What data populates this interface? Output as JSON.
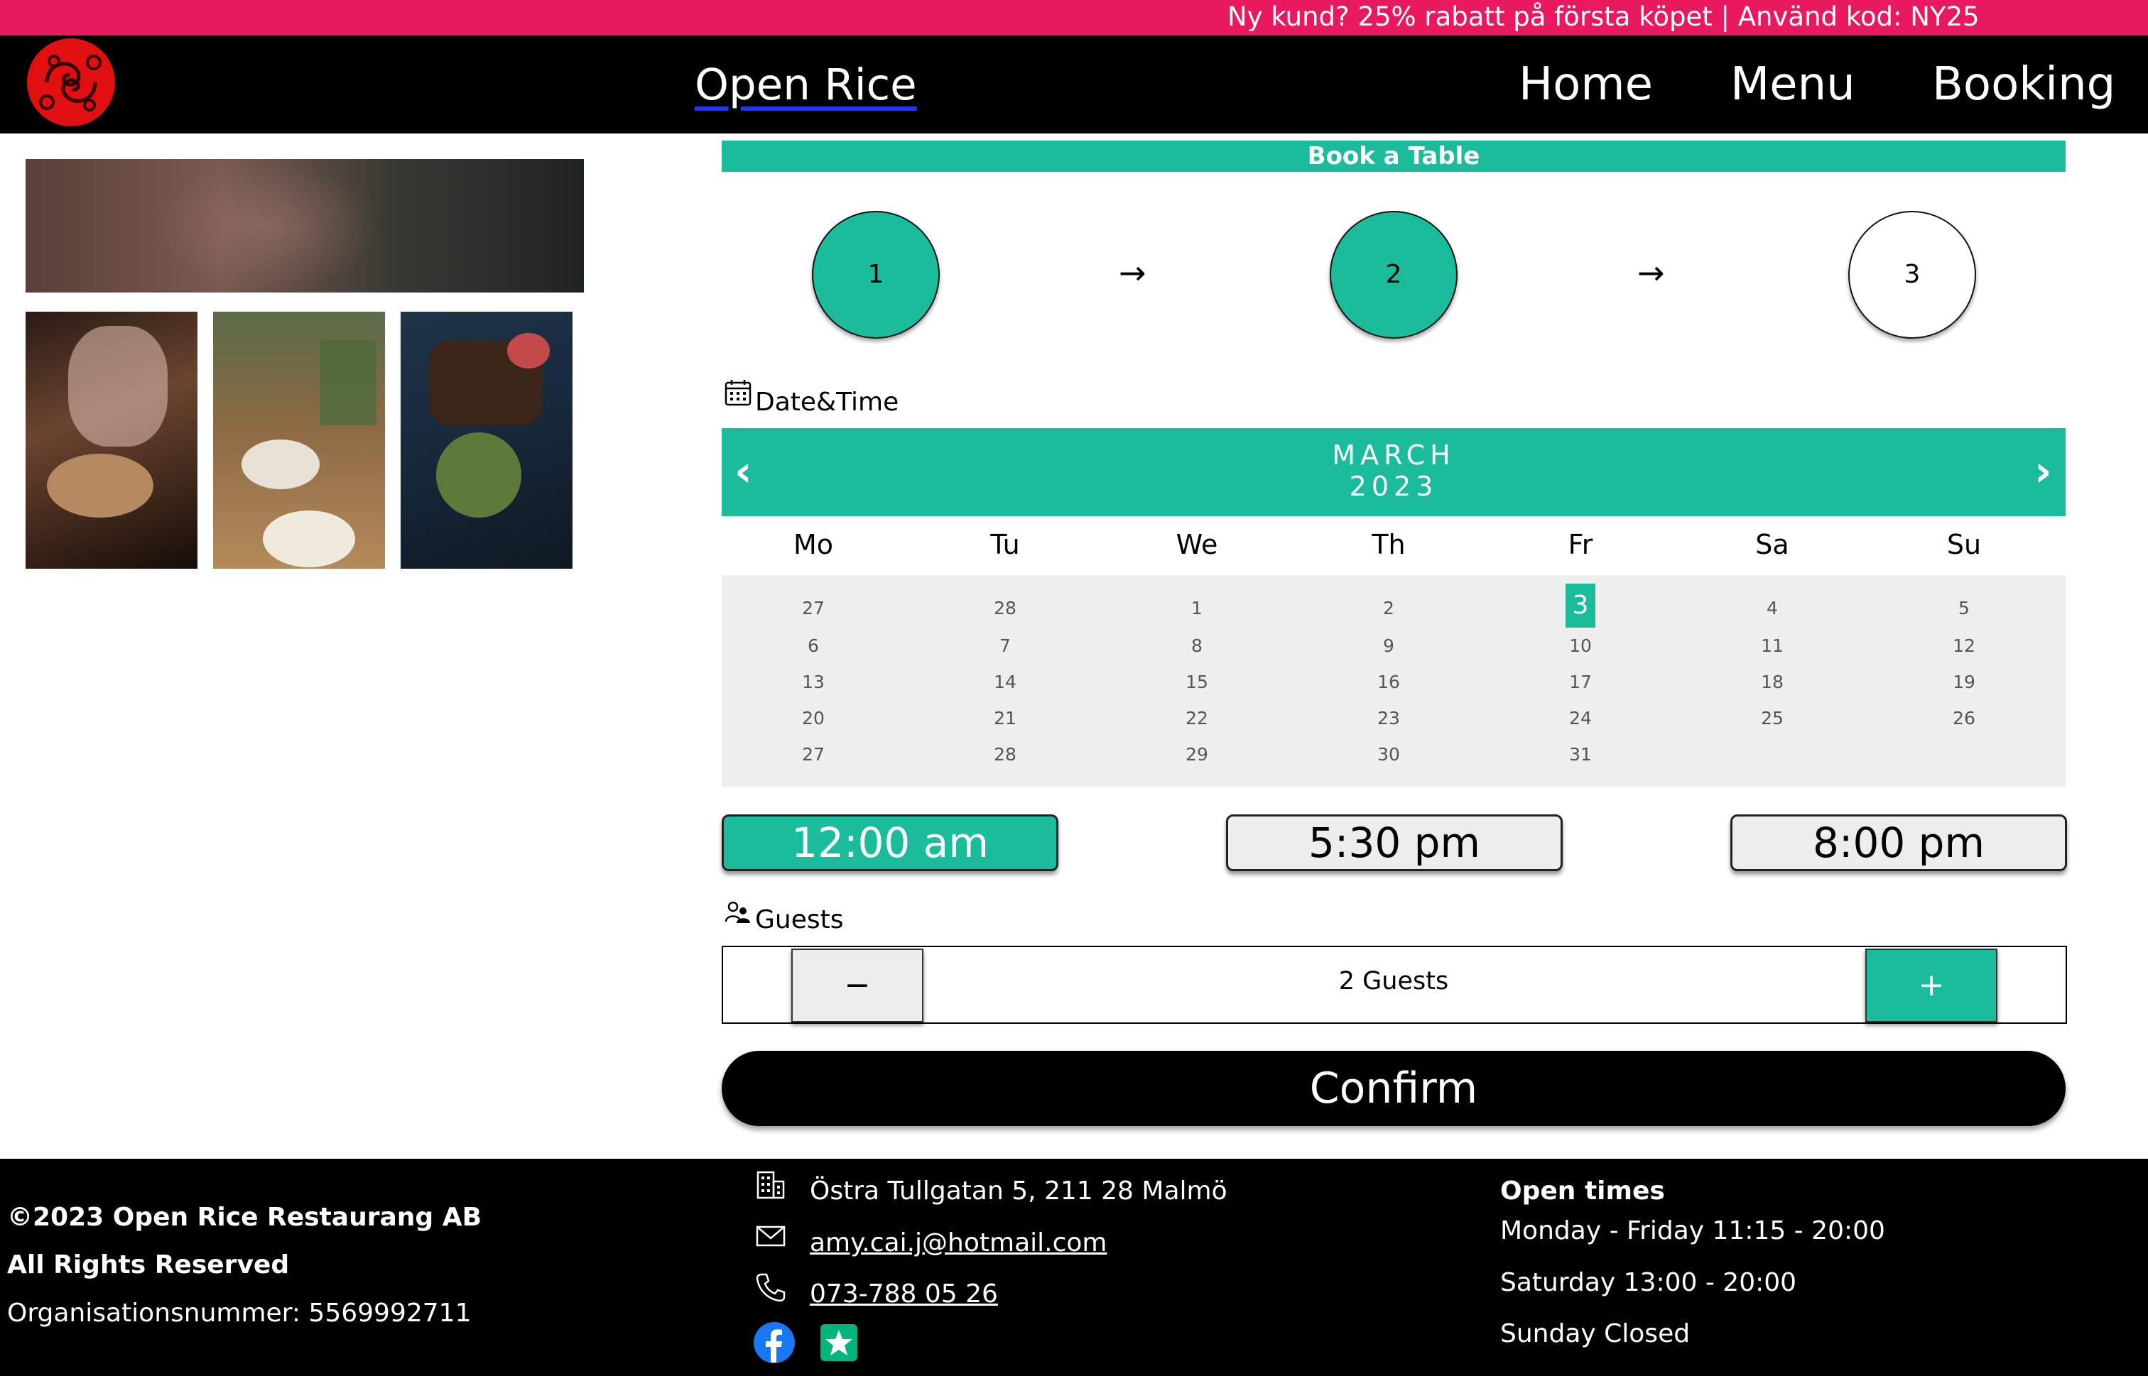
{
  "promo": {
    "text": "Ny kund? 25% rabatt på första köpet | Använd kod: NY25"
  },
  "header": {
    "brand": "Open Rice",
    "nav": [
      "Home",
      "Menu",
      "Booking"
    ]
  },
  "booking": {
    "title": "Book a Table",
    "steps": [
      {
        "label": "1",
        "active": true
      },
      {
        "label": "2",
        "active": true
      },
      {
        "label": "3",
        "active": false
      }
    ],
    "step_arrow": "→",
    "datetime_label": "Date&Time",
    "calendar": {
      "month": "MARCH",
      "year": "2023",
      "prev": "‹",
      "next": "›",
      "weekdays": [
        "Mo",
        "Tu",
        "We",
        "Th",
        "Fr",
        "Sa",
        "Su"
      ],
      "weeks": [
        [
          "27",
          "28",
          "1",
          "2",
          "3",
          "4",
          "5"
        ],
        [
          "6",
          "7",
          "8",
          "9",
          "10",
          "11",
          "12"
        ],
        [
          "13",
          "14",
          "15",
          "16",
          "17",
          "18",
          "19"
        ],
        [
          "20",
          "21",
          "22",
          "23",
          "24",
          "25",
          "26"
        ],
        [
          "27",
          "28",
          "29",
          "30",
          "31",
          "",
          ""
        ]
      ],
      "selected": "3"
    },
    "times": [
      {
        "label": "12:00 am",
        "selected": true
      },
      {
        "label": "5:30 pm",
        "selected": false
      },
      {
        "label": "8:00 pm",
        "selected": false
      }
    ],
    "guests_label": "Guests",
    "minus": "−",
    "plus": "+",
    "guest_count": "2 Guests",
    "confirm": "Confirm"
  },
  "footer": {
    "copyright": "©2023 Open Rice Restaurang AB",
    "rights": "All Rights Reserved",
    "org": "Organisationsnummer: 5569992711",
    "address": "Östra Tullgatan 5, 211 28 Malmö",
    "email": "amy.cai.j@hotmail.com",
    "phone": "073-788 05 26",
    "open_title": "Open times",
    "hours": [
      "Monday - Friday 11:15 - 20:00",
      "Saturday 13:00 - 20:00",
      "Sunday Closed"
    ]
  },
  "colors": {
    "accent": "#1abc9c",
    "promo": "#e8195e",
    "logo": "#e01010"
  },
  "icons": [
    "restaurant-logo",
    "calendar-icon",
    "guests-icon",
    "building-icon",
    "mail-icon",
    "phone-icon",
    "facebook-icon",
    "review-star-icon"
  ]
}
